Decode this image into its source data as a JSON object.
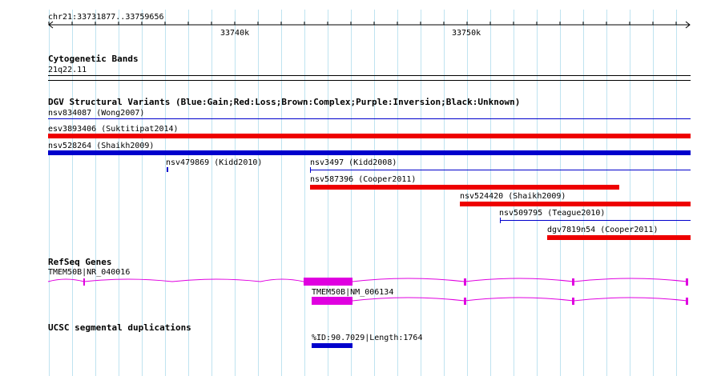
{
  "ruler": {
    "location": "chr21:33731877..33759656",
    "ticks": [
      "33740k",
      "33750k"
    ]
  },
  "tracks": {
    "cytoband": {
      "title": "Cytogenetic Bands",
      "band": "21q22.11"
    },
    "dgv": {
      "title": "DGV Structural Variants (Blue:Gain;Red:Loss;Brown:Complex;Purple:Inversion;Black:Unknown)",
      "variants": [
        {
          "label": "nsv834087 (Wong2007)",
          "type": "gain",
          "thick": false
        },
        {
          "label": "esv3893406 (Suktitipat2014)",
          "type": "loss",
          "thick": true
        },
        {
          "label": "nsv528264 (Shaikh2009)",
          "type": "gain",
          "thick": true
        },
        {
          "label": "nsv479869 (Kidd2010)",
          "type": "gain",
          "thick": true
        },
        {
          "label": "nsv3497 (Kidd2008)",
          "type": "gain",
          "thick": false
        },
        {
          "label": "nsv587396 (Cooper2011)",
          "type": "loss",
          "thick": true
        },
        {
          "label": "nsv524420 (Shaikh2009)",
          "type": "loss",
          "thick": true
        },
        {
          "label": "nsv509795 (Teague2010)",
          "type": "gain",
          "thick": false
        },
        {
          "label": "dgv7819n54 (Cooper2011)",
          "type": "loss",
          "thick": true
        }
      ]
    },
    "refseq": {
      "title": "RefSeq Genes",
      "transcripts": [
        "TMEM50B|NR_040016",
        "TMEM50B|NM_006134"
      ]
    },
    "segdup": {
      "title": "UCSC segmental duplications",
      "feature": "%ID:90.7029|Length:1764"
    }
  },
  "colors": {
    "gain": "#0000cc",
    "loss": "#ee0000",
    "gene": "#e000e0",
    "segdup": "#0000cc",
    "grid": "#bfe3f0"
  }
}
